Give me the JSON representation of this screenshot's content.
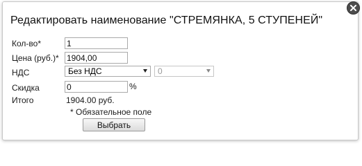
{
  "dialog": {
    "title": "Редактировать наименование \"СТРЕМЯНКА, 5 СТУПЕНЕЙ\"",
    "close_icon": "close-icon"
  },
  "form": {
    "quantity": {
      "label": "Кол-во*",
      "value": "1"
    },
    "price": {
      "label": "Цена (руб.)*",
      "value": "1904,00"
    },
    "vat": {
      "label": "НДС",
      "type_selected": "Без НДС",
      "rate_selected": "0"
    },
    "discount": {
      "label": "Скидка",
      "value": "0",
      "unit": "%"
    },
    "total": {
      "label": "Итого",
      "value": "1904.00 руб."
    },
    "required_note": "* Обязательное поле",
    "submit_label": "Выбрать"
  }
}
